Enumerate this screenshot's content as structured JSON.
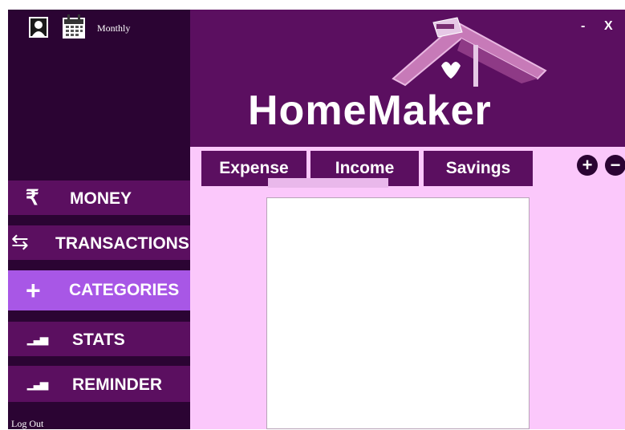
{
  "app": {
    "brand": "HomeMaker"
  },
  "sidebar": {
    "period_label": "Monthly",
    "items": [
      {
        "label": "MONEY",
        "icon": "rupee-icon",
        "glyph": "₹"
      },
      {
        "label": "TRANSACTIONS",
        "icon": "transfer-arrows-icon",
        "glyph": "⇆"
      },
      {
        "label": "CATEGORIES",
        "icon": "plus-icon",
        "glyph": "+"
      },
      {
        "label": "STATS",
        "icon": "bar-chart-icon",
        "glyph": "▁▃▅"
      },
      {
        "label": "REMINDER",
        "icon": "bar-chart-icon",
        "glyph": "▁▃▅"
      }
    ],
    "active_item": "CATEGORIES",
    "logout_label": "Log Out"
  },
  "window": {
    "minimize": "-",
    "close": "X"
  },
  "tabs": [
    {
      "label": "Expense"
    },
    {
      "label": "Income"
    },
    {
      "label": "Savings"
    }
  ],
  "actions": {
    "add": "+",
    "remove": "−"
  },
  "colors": {
    "sidebar_bg": "#2b0433",
    "header_bg": "#5b0f60",
    "content_bg": "#fbc8fb",
    "active_nav": "#a857e6"
  }
}
